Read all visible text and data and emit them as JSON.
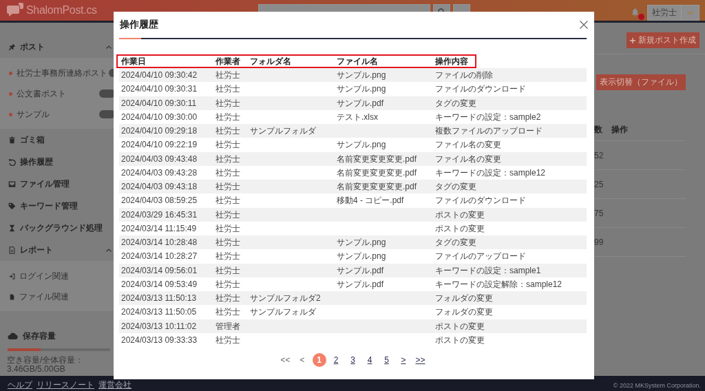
{
  "header": {
    "logo": "ShalomPost.cs",
    "notification": {
      "unread": true
    },
    "user_menu": {
      "label": "社労士"
    }
  },
  "sidebar": {
    "menu": [
      {
        "label": "ポスト",
        "expanded": true,
        "children": [
          {
            "kind": "post",
            "label": "社労士事務所連絡ポスト"
          },
          {
            "kind": "post",
            "label": "公文書ポスト"
          },
          {
            "kind": "post",
            "label": "サンプル"
          }
        ]
      },
      {
        "label": "ゴミ箱"
      },
      {
        "label": "操作履歴"
      },
      {
        "label": "ファイル管理"
      },
      {
        "label": "キーワード管理"
      },
      {
        "label": "バックグラウンド処理"
      },
      {
        "label": "レポート",
        "expanded": true,
        "children": [
          {
            "kind": "report",
            "label": "ログイン関連"
          },
          {
            "kind": "report",
            "label": "ファイル関連"
          }
        ]
      }
    ],
    "storage": {
      "label": "保存容量",
      "level": 0.32,
      "reading": "空き容量/全体容量：3.46GB/5.00GB"
    }
  },
  "main": {
    "create_button": "新規ポスト作成",
    "view_toggle_button": "表示切替（ファイル）",
    "table": {
      "columns": [
        "数",
        "操作"
      ],
      "rows": [
        [
          "52"
        ],
        [
          "25"
        ],
        [
          "75"
        ],
        [
          "99"
        ]
      ]
    }
  },
  "modal": {
    "title": "操作履歴",
    "table": {
      "header_highlighted": true,
      "columns": [
        "作業日",
        "作業者",
        "フォルダ名",
        "ファイル名",
        "操作内容"
      ],
      "rows": [
        {
          "date": "2024/04/10 09:30:42",
          "worker": "社労士",
          "file": "サンプル.png",
          "operation": "ファイルの削除"
        },
        {
          "date": "2024/04/10 09:30:31",
          "worker": "社労士",
          "file": "サンプル.png",
          "operation": "ファイルのダウンロード"
        },
        {
          "date": "2024/04/10 09:30:11",
          "worker": "社労士",
          "file": "サンプル.pdf",
          "operation": "タグの変更"
        },
        {
          "date": "2024/04/10 09:30:00",
          "worker": "社労士",
          "file": "テスト.xlsx",
          "operation": "キーワードの設定：sample2"
        },
        {
          "date": "2024/04/10 09:29:18",
          "worker": "社労士",
          "folder": "サンプルフォルダ",
          "operation": "複数ファイルのアップロード"
        },
        {
          "date": "2024/04/10 09:22:19",
          "worker": "社労士",
          "file": "サンプル.png",
          "operation": "ファイル名の変更"
        },
        {
          "date": "2024/04/03 09:43:48",
          "worker": "社労士",
          "file": "名前変更変更変更.pdf",
          "operation": "ファイル名の変更"
        },
        {
          "date": "2024/04/03 09:43:28",
          "worker": "社労士",
          "file": "名前変更変更変更.pdf",
          "operation": "キーワードの設定：sample12"
        },
        {
          "date": "2024/04/03 09:43:18",
          "worker": "社労士",
          "file": "名前変更変更変更.pdf",
          "operation": "タグの変更"
        },
        {
          "date": "2024/04/03 08:59:25",
          "worker": "社労士",
          "file": "移動4 - コピー.pdf",
          "operation": "ファイルのダウンロード"
        },
        {
          "date": "2024/03/29 16:45:31",
          "worker": "社労士",
          "operation": "ポストの変更"
        },
        {
          "date": "2024/03/14 11:15:49",
          "worker": "社労士",
          "operation": "ポストの変更"
        },
        {
          "date": "2024/03/14 10:28:48",
          "worker": "社労士",
          "file": "サンプル.png",
          "operation": "タグの変更"
        },
        {
          "date": "2024/03/14 10:28:27",
          "worker": "社労士",
          "file": "サンプル.png",
          "operation": "ファイルのアップロード"
        },
        {
          "date": "2024/03/14 09:56:01",
          "worker": "社労士",
          "file": "サンプル.pdf",
          "operation": "キーワードの設定：sample1"
        },
        {
          "date": "2024/03/14 09:53:49",
          "worker": "社労士",
          "file": "サンプル.pdf",
          "operation": "キーワードの設定解除：sample12"
        },
        {
          "date": "2024/03/13 11:50:13",
          "worker": "社労士",
          "folder": "サンプルフォルダ2",
          "operation": "フォルダの変更"
        },
        {
          "date": "2024/03/13 11:50:05",
          "worker": "社労士",
          "folder": "サンプルフォルダ",
          "operation": "フォルダの変更"
        },
        {
          "date": "2024/03/13 10:11:02",
          "worker": "管理者",
          "operation": "ポストの変更"
        },
        {
          "date": "2024/03/13 09:33:33",
          "worker": "社労士",
          "operation": "ポストの変更"
        }
      ]
    },
    "pagination": [
      {
        "label": "<<",
        "selected": false,
        "disabled": true
      },
      {
        "label": "<",
        "selected": false,
        "disabled": true
      },
      {
        "label": "1",
        "selected": true,
        "disabled": false
      },
      {
        "label": "2",
        "selected": false,
        "disabled": false
      },
      {
        "label": "3",
        "selected": false,
        "disabled": false
      },
      {
        "label": "4",
        "selected": false,
        "disabled": false
      },
      {
        "label": "5",
        "selected": false,
        "disabled": false
      },
      {
        "label": ">",
        "selected": false,
        "disabled": false
      },
      {
        "label": ">>",
        "selected": false,
        "disabled": false
      }
    ]
  },
  "footer": {
    "links": [
      "ヘルプ",
      "リリースノート",
      "運営会社"
    ],
    "copyright": "© 2022 MKSystem Corporation."
  }
}
